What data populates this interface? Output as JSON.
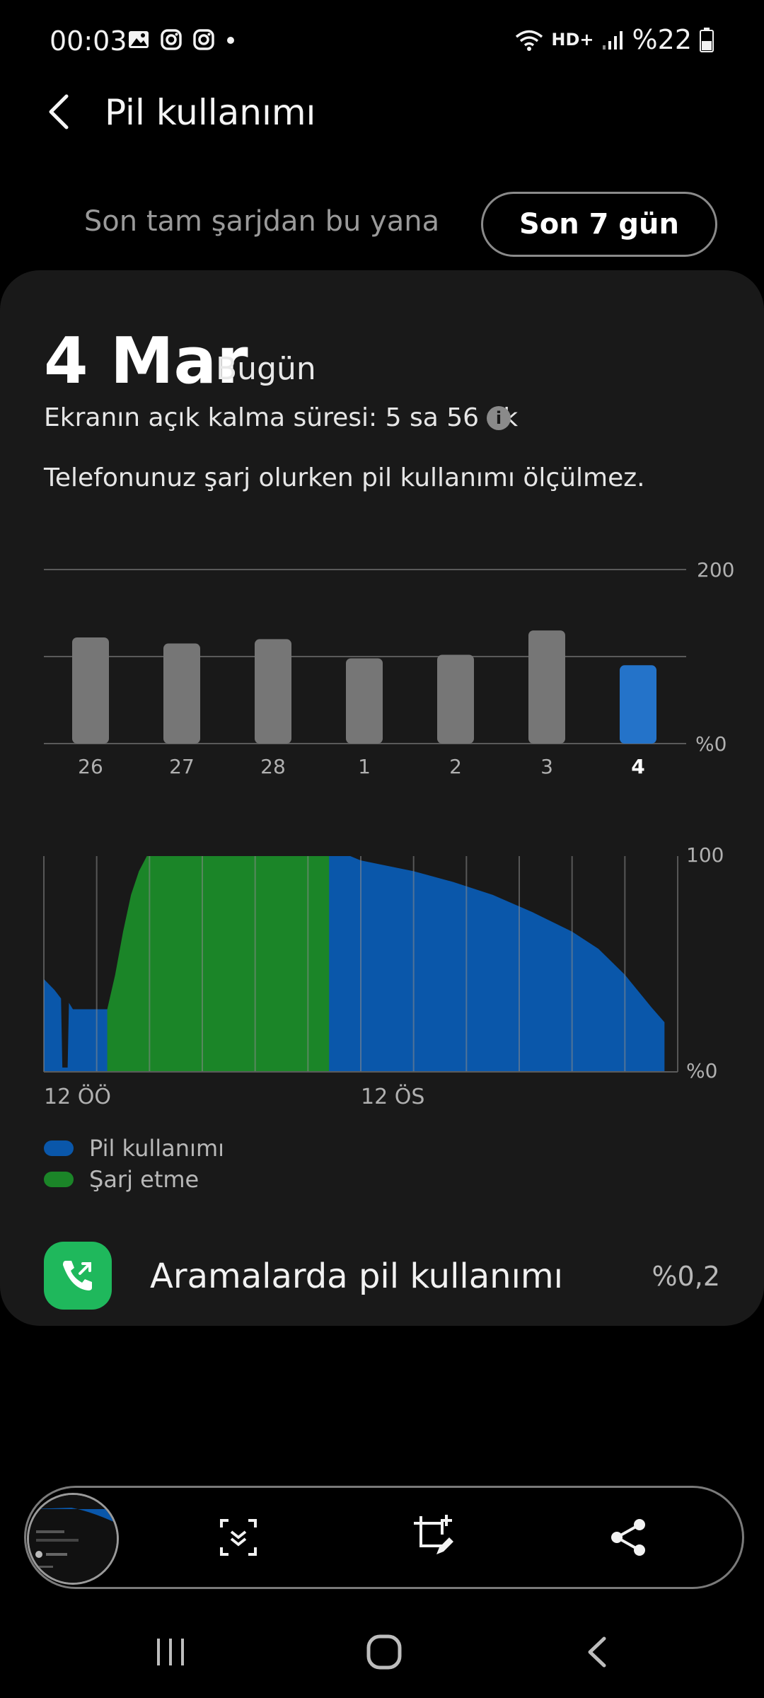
{
  "status_bar": {
    "time": "00:03",
    "network": "HD+",
    "battery": "%22"
  },
  "header": {
    "title": "Pil kullanımı"
  },
  "tabs": {
    "since_full_charge": "Son tam şarjdan bu yana",
    "last_7_days": "Son 7 gün",
    "selected": "last_7_days"
  },
  "summary": {
    "date": "4 Mar",
    "today": "Bugün",
    "screen_on_time": "Ekranın açık kalma süresi: 5 sa 56 dk",
    "charging_note": "Telefonunuz şarj olurken pil kullanımı ölçülmez."
  },
  "weekly_chart": {
    "type": "bar",
    "categories": [
      "26",
      "27",
      "28",
      "1",
      "2",
      "3",
      "4"
    ],
    "values": [
      122,
      115,
      120,
      98,
      102,
      130,
      90
    ],
    "selected_index": 6,
    "y_top_label": "200",
    "y_bottom_label": "%0",
    "ylim": [
      0,
      200
    ],
    "colors": {
      "bar": "#767676",
      "selected": "#2473c9",
      "grid": "#5a5a5a"
    }
  },
  "daily_chart": {
    "type": "area",
    "y_top_label": "100",
    "y_bottom_label": "%0",
    "x_label_start": "12 ÖÖ",
    "x_label_noon": "12 ÖS",
    "ylim": [
      0,
      100
    ],
    "series": [
      {
        "name": "Pil kullanımı",
        "color": "#0a57aa",
        "points": [
          [
            0,
            43
          ],
          [
            0.4,
            38
          ],
          [
            0.65,
            34
          ],
          [
            0.7,
            2
          ],
          [
            0.9,
            2
          ],
          [
            0.95,
            32
          ],
          [
            1.1,
            29
          ],
          [
            2.2,
            29
          ],
          [
            2.4,
            29
          ],
          [
            10.8,
            100
          ],
          [
            11.6,
            100
          ],
          [
            12.0,
            98
          ],
          [
            12.8,
            96
          ],
          [
            14.0,
            93
          ],
          [
            15.5,
            88
          ],
          [
            17.0,
            82
          ],
          [
            18.5,
            74
          ],
          [
            20.0,
            65
          ],
          [
            21.0,
            57
          ],
          [
            22.0,
            45
          ],
          [
            23.0,
            30
          ],
          [
            23.5,
            23
          ]
        ]
      },
      {
        "name": "Şarj etme",
        "color": "#1b8528",
        "points": [
          [
            2.4,
            0
          ],
          [
            2.4,
            29
          ],
          [
            2.7,
            45
          ],
          [
            3.0,
            65
          ],
          [
            3.3,
            82
          ],
          [
            3.6,
            93
          ],
          [
            3.9,
            100
          ],
          [
            10.8,
            100
          ],
          [
            10.8,
            0
          ]
        ]
      }
    ]
  },
  "legend": {
    "usage": "Pil kullanımı",
    "charging": "Şarj etme",
    "usage_color": "#0a57aa",
    "charging_color": "#1b8528"
  },
  "calls": {
    "label": "Aramalarda pil kullanımı",
    "value": "%0,2"
  }
}
